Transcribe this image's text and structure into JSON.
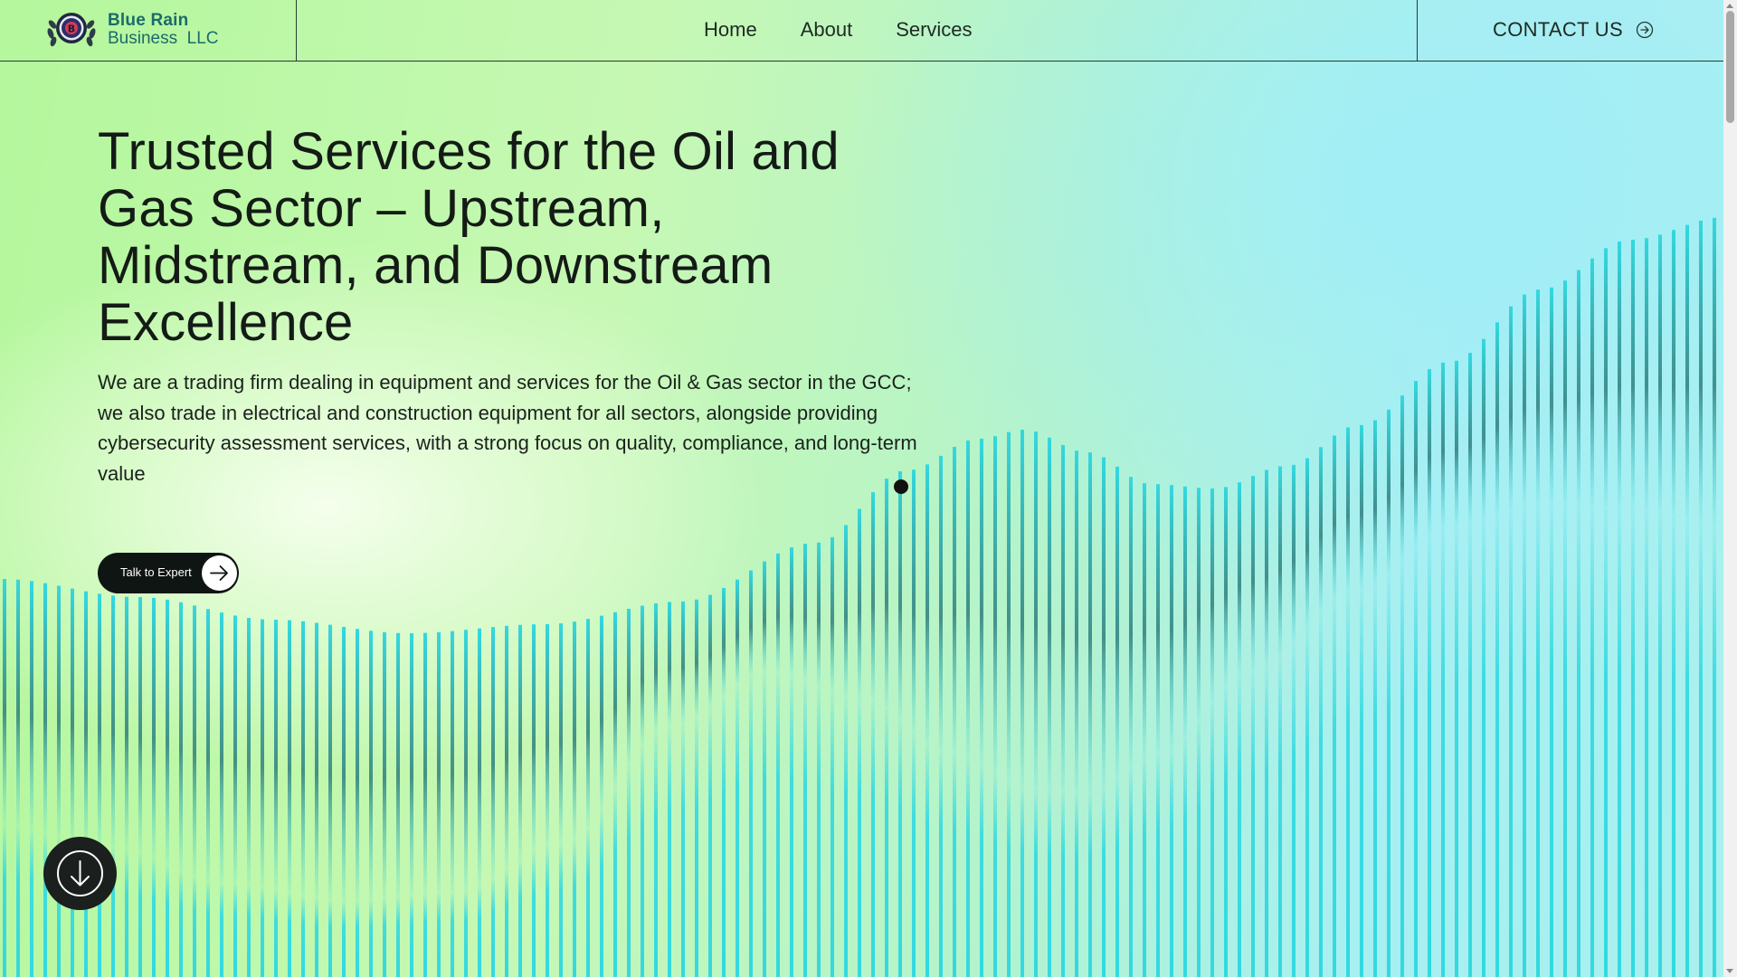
{
  "brand": {
    "name_line1": "Blue Rain",
    "name_line2": "Business  LLC",
    "emblem_letter": "B"
  },
  "nav": {
    "items": [
      {
        "label": "Home"
      },
      {
        "label": "About"
      },
      {
        "label": "Services"
      }
    ]
  },
  "contact": {
    "label": "CONTACT US",
    "icon": "arrow-right-circle-icon"
  },
  "hero": {
    "title": "Trusted Services for the Oil and Gas Sector – Upstream, Midstream, and Downstream Excellence",
    "description": "We are a trading firm dealing in equipment and services for the Oil & Gas sector in the GCC; we also trade in electrical and construction equipment for all sectors, alongside providing cybersecurity assessment services, with a strong focus on quality, compliance, and long-term value",
    "cta_label": "Talk to Expert",
    "cta_icon": "arrow-right-icon"
  },
  "scroll_button": {
    "icon": "arrow-down-icon"
  },
  "colors": {
    "bar_cyan": "#33d9e0",
    "bar_dark": "#2f7f7d",
    "text_dark": "#141b16",
    "brand_teal": "#1c6b6a",
    "button_dark": "#0f1512"
  }
}
